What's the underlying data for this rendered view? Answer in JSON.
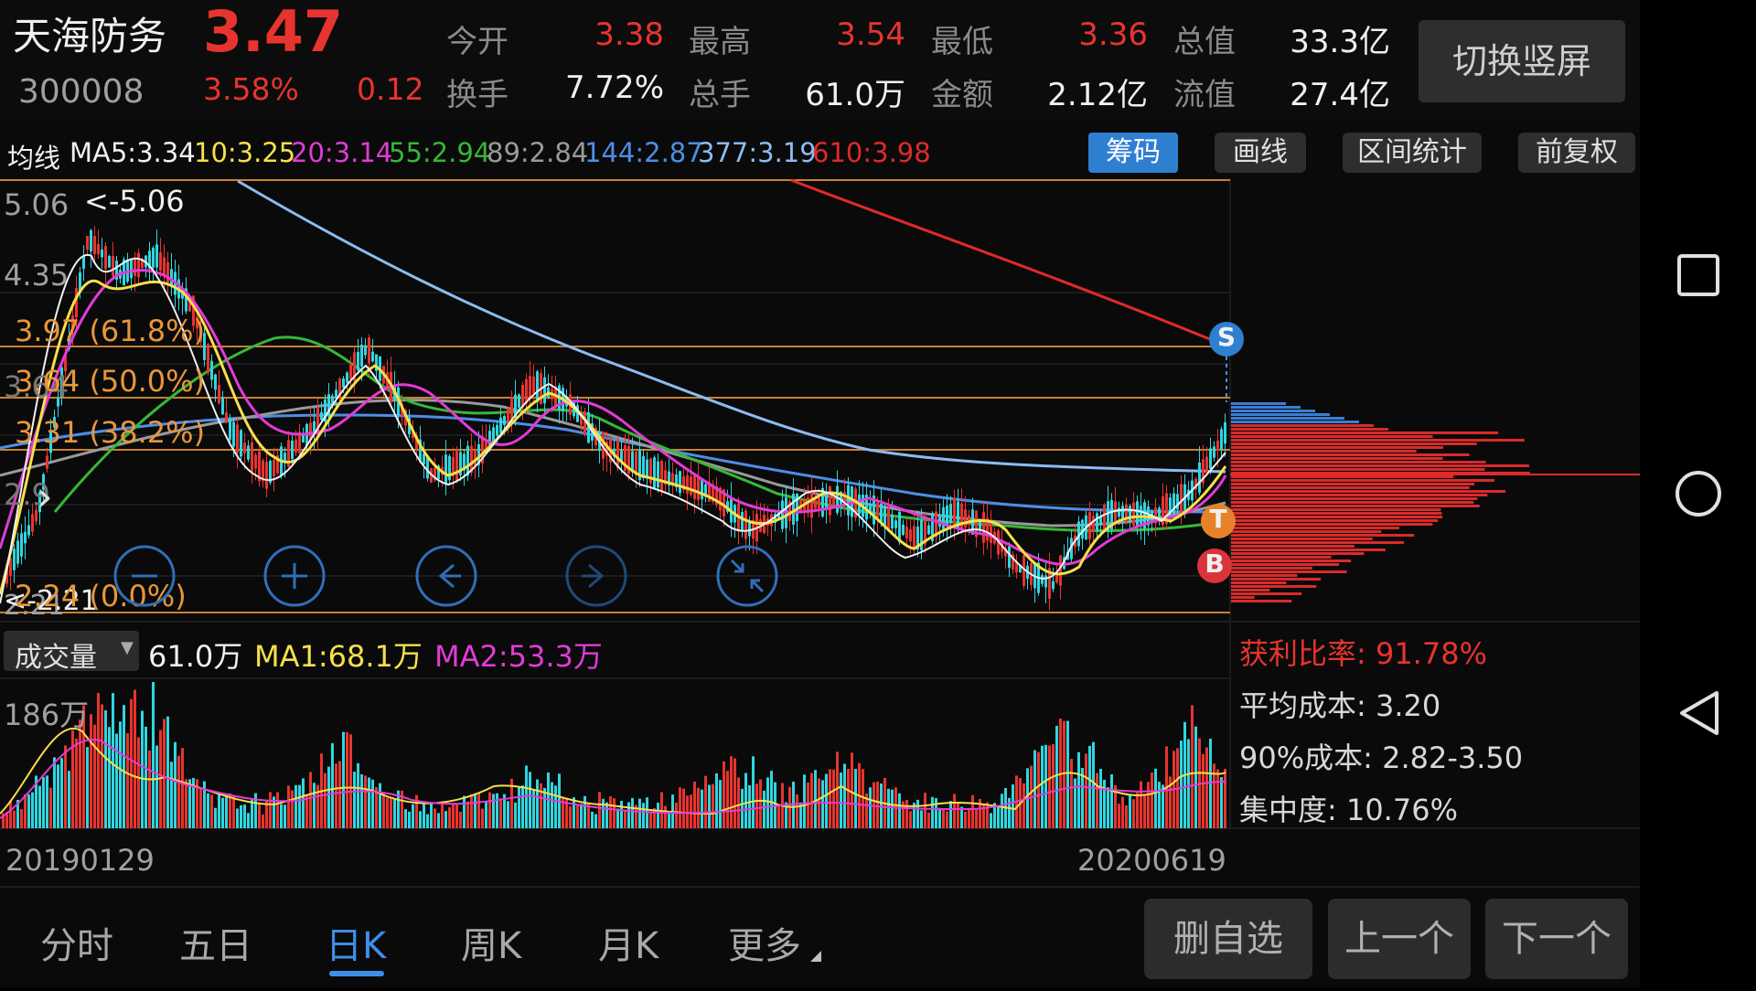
{
  "stock": {
    "name": "天海防务",
    "code": "300008",
    "price": "3.47",
    "change_pct": "3.58%",
    "change": "0.12",
    "switch_button": "切换竖屏"
  },
  "quote": {
    "open_label": "今开",
    "open": "3.38",
    "high_label": "最高",
    "high": "3.54",
    "low_label": "最低",
    "low": "3.36",
    "mcap_label": "总值",
    "mcap": "33.3亿",
    "turnover_label": "换手",
    "turnover": "7.72%",
    "volume_label": "总手",
    "volume": "61.0万",
    "amount_label": "金额",
    "amount": "2.12亿",
    "float_label": "流值",
    "float": "27.4亿"
  },
  "ma_bar": {
    "label": "均线",
    "ma5": "MA5:3.34",
    "ma10": "10:3.25",
    "ma20": "20:3.14",
    "ma55": "55:2.94",
    "ma89": "89:2.84",
    "ma144": "144:2.87",
    "ma377": "377:3.19",
    "ma610": "610:3.98"
  },
  "toolbar": {
    "chips": "筹码",
    "draw": "画线",
    "range_stats": "区间统计",
    "adjust": "前复权"
  },
  "price_chart": {
    "y_top": "5.06",
    "y_2": "4.35",
    "y_3": "3.64",
    "y_4": "2.9",
    "y_bottom": "2.21",
    "max_marker": "<-5.06",
    "min_marker": "<-2.21",
    "fib": [
      {
        "label": "3.97 (61.8%)"
      },
      {
        "label": "3.64 (50.0%)"
      },
      {
        "label": "3.31 (38.2%)"
      },
      {
        "label": "2.24 (0.0%)"
      }
    ],
    "markers": {
      "s": "S",
      "t": "T",
      "b": "B"
    }
  },
  "volume_panel": {
    "selector": "成交量",
    "current": "61.0万",
    "ma1": "MA1:68.1万",
    "ma2": "MA2:53.3万",
    "y_top": "186万"
  },
  "chip_stats": {
    "profit_ratio": "获利比率: 91.78%",
    "avg_cost": "平均成本: 3.20",
    "cost_90": "90%成本: 2.82-3.50",
    "concentration": "集中度: 10.76%"
  },
  "dates": {
    "start": "20190129",
    "end": "20200619"
  },
  "tabs": [
    {
      "label": "分时"
    },
    {
      "label": "五日"
    },
    {
      "label": "日K"
    },
    {
      "label": "周K"
    },
    {
      "label": "月K"
    },
    {
      "label": "更多"
    }
  ],
  "bottom_buttons": {
    "delete": "删自选",
    "prev": "上一个",
    "next": "下一个"
  },
  "colors": {
    "up": "#e8342f",
    "down": "#2fd6e0",
    "accent": "#2f7fd1",
    "fib": "#e8963a",
    "ma5": "#f0f0f0",
    "ma10": "#f5e04b",
    "ma20": "#e23bd6",
    "ma55": "#36b836",
    "ma89": "#9a9a9a",
    "ma144": "#4d8ee6",
    "ma377": "#8bbcf2",
    "ma610": "#e02a2a"
  }
}
